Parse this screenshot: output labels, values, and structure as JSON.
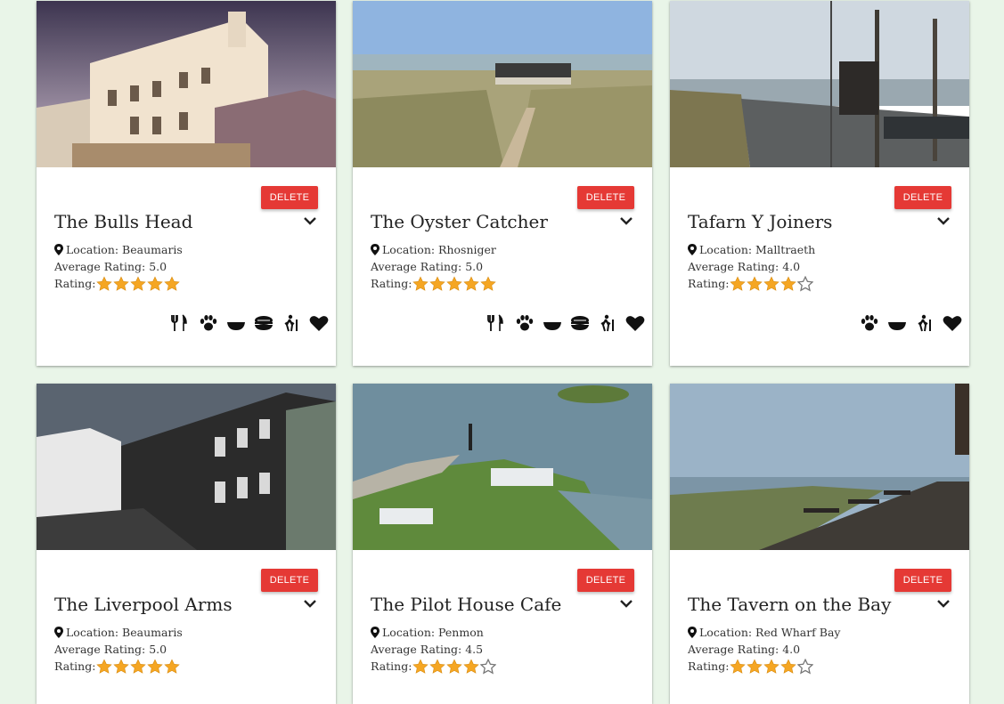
{
  "cards": [
    {
      "title": "The Bulls Head",
      "location": "Location: Beaumaris",
      "avg": "Average Rating: 5.0",
      "rating_label": "Rating:",
      "rating": 5,
      "delete": "DELETE",
      "amenities": [
        "food-icon",
        "paw-icon",
        "bowl-icon",
        "pie-icon",
        "hiking-icon",
        "heart-icon"
      ]
    },
    {
      "title": "The Oyster Catcher",
      "location": "Location: Rhosniger",
      "avg": "Average Rating: 5.0",
      "rating_label": "Rating:",
      "rating": 5,
      "delete": "DELETE",
      "amenities": [
        "food-icon",
        "paw-icon",
        "bowl-icon",
        "pie-icon",
        "hiking-icon",
        "heart-icon"
      ]
    },
    {
      "title": "Tafarn Y Joiners",
      "location": "Location: Malltraeth",
      "avg": "Average Rating: 4.0",
      "rating_label": "Rating:",
      "rating": 4,
      "delete": "DELETE",
      "amenities": [
        "paw-icon",
        "bowl-icon",
        "hiking-icon",
        "heart-icon"
      ]
    },
    {
      "title": "The Liverpool Arms",
      "location": "Location: Beaumaris",
      "avg": "Average Rating: 5.0",
      "rating_label": "Rating:",
      "rating": 5,
      "delete": "DELETE",
      "amenities": []
    },
    {
      "title": "The Pilot House Cafe",
      "location": "Location: Penmon",
      "avg": "Average Rating: 4.5",
      "rating_label": "Rating:",
      "rating": 4,
      "delete": "DELETE",
      "amenities": []
    },
    {
      "title": "The Tavern on the Bay",
      "location": "Location: Red Wharf Bay",
      "avg": "Average Rating: 4.0",
      "rating_label": "Rating:",
      "rating": 4,
      "delete": "DELETE",
      "amenities": []
    }
  ],
  "colors": {
    "delete": "#e53935",
    "star": "#f5a623",
    "star_empty": "#777777",
    "background": "#e9f5e8"
  }
}
